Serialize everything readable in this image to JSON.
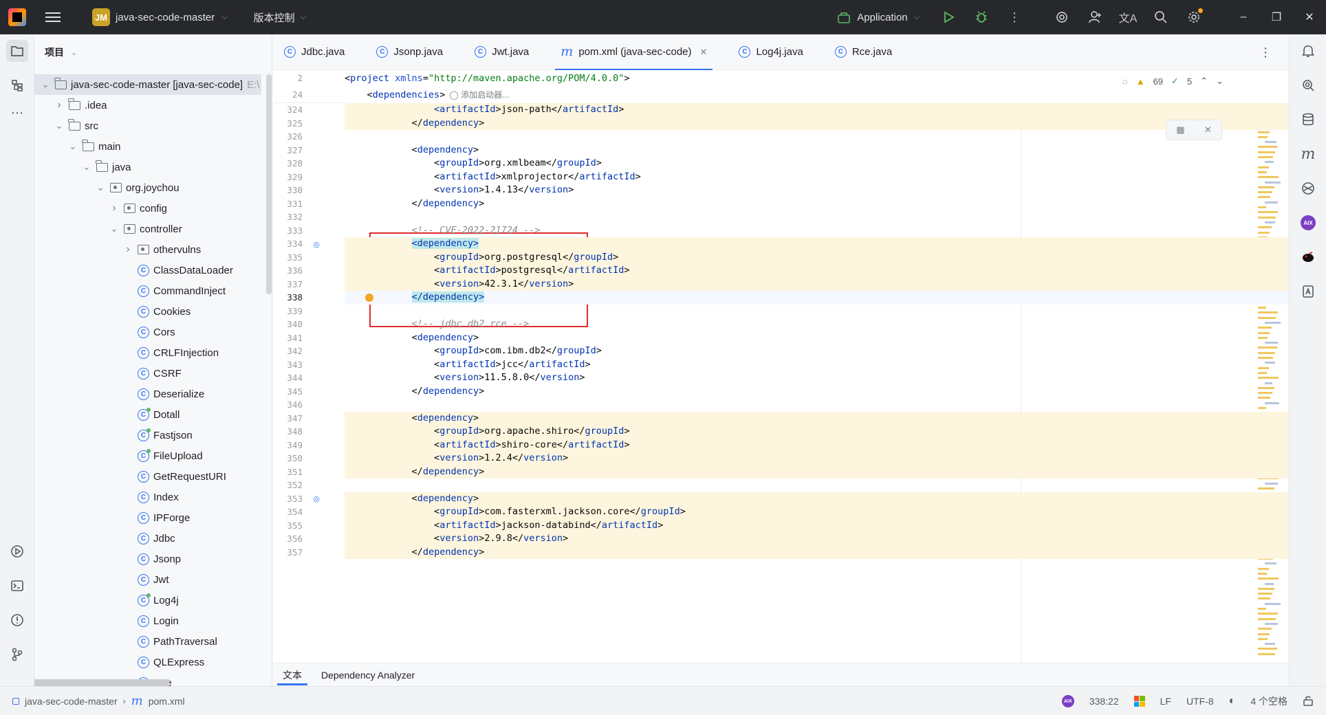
{
  "titlebar": {
    "project_avatar": "JM",
    "project_name": "java-sec-code-master",
    "vcs_label": "版本控制",
    "run_config": "Application"
  },
  "project_panel": {
    "title": "项目",
    "tree": [
      {
        "label": "java-sec-code-master [java-sec-code]",
        "suffix": "E:\\",
        "depth": 0,
        "kind": "module",
        "open": true
      },
      {
        "label": ".idea",
        "depth": 1,
        "kind": "folder",
        "open": false
      },
      {
        "label": "src",
        "depth": 1,
        "kind": "folder",
        "open": true
      },
      {
        "label": "main",
        "depth": 2,
        "kind": "folder",
        "open": true
      },
      {
        "label": "java",
        "depth": 3,
        "kind": "folder",
        "open": true
      },
      {
        "label": "org.joychou",
        "depth": 4,
        "kind": "package",
        "open": true
      },
      {
        "label": "config",
        "depth": 5,
        "kind": "package",
        "open": false
      },
      {
        "label": "controller",
        "depth": 5,
        "kind": "package",
        "open": true
      },
      {
        "label": "othervulns",
        "depth": 6,
        "kind": "package",
        "open": false
      },
      {
        "label": "ClassDataLoader",
        "depth": 6,
        "kind": "class"
      },
      {
        "label": "CommandInject",
        "depth": 6,
        "kind": "class"
      },
      {
        "label": "Cookies",
        "depth": 6,
        "kind": "class"
      },
      {
        "label": "Cors",
        "depth": 6,
        "kind": "class"
      },
      {
        "label": "CRLFInjection",
        "depth": 6,
        "kind": "class"
      },
      {
        "label": "CSRF",
        "depth": 6,
        "kind": "class"
      },
      {
        "label": "Deserialize",
        "depth": 6,
        "kind": "class"
      },
      {
        "label": "Dotall",
        "depth": 6,
        "kind": "class-g"
      },
      {
        "label": "Fastjson",
        "depth": 6,
        "kind": "class-g"
      },
      {
        "label": "FileUpload",
        "depth": 6,
        "kind": "class-g"
      },
      {
        "label": "GetRequestURI",
        "depth": 6,
        "kind": "class"
      },
      {
        "label": "Index",
        "depth": 6,
        "kind": "class"
      },
      {
        "label": "IPForge",
        "depth": 6,
        "kind": "class"
      },
      {
        "label": "Jdbc",
        "depth": 6,
        "kind": "class"
      },
      {
        "label": "Jsonp",
        "depth": 6,
        "kind": "class"
      },
      {
        "label": "Jwt",
        "depth": 6,
        "kind": "class"
      },
      {
        "label": "Log4j",
        "depth": 6,
        "kind": "class-g"
      },
      {
        "label": "Login",
        "depth": 6,
        "kind": "class"
      },
      {
        "label": "PathTraversal",
        "depth": 6,
        "kind": "class"
      },
      {
        "label": "QLExpress",
        "depth": 6,
        "kind": "class"
      },
      {
        "label": "Rce",
        "depth": 6,
        "kind": "class"
      }
    ]
  },
  "tabs": [
    {
      "label": "Jdbc.java",
      "icon": "class-icon",
      "active": false
    },
    {
      "label": "Jsonp.java",
      "icon": "class-icon",
      "active": false
    },
    {
      "label": "Jwt.java",
      "icon": "class-icon",
      "active": false
    },
    {
      "label": "pom.xml (java-sec-code)",
      "icon": "maven-icon",
      "active": true
    },
    {
      "label": "Log4j.java",
      "icon": "class-icon",
      "active": false
    },
    {
      "label": "Rce.java",
      "icon": "class-icon",
      "active": false
    }
  ],
  "inspections": {
    "warnings": "69",
    "ok": "5"
  },
  "sticky_lines": [
    {
      "num": "2",
      "html_kind": "project"
    },
    {
      "num": "24",
      "html_kind": "dependencies",
      "hint": "添加启动器..."
    }
  ],
  "code_lines": [
    {
      "num": "324",
      "indent": 2,
      "tokens": [
        [
          "t",
          "<artifactId"
        ],
        [
          "b",
          ">json-path</"
        ],
        [
          "t",
          "artifactId"
        ],
        [
          "b",
          ">"
        ]
      ],
      "hl": true
    },
    {
      "num": "325",
      "indent": 1,
      "tokens": [
        [
          "b",
          "</"
        ],
        [
          "t",
          "dependency"
        ],
        [
          "b",
          ">"
        ]
      ],
      "hl": true
    },
    {
      "num": "326",
      "indent": 0,
      "tokens": []
    },
    {
      "num": "327",
      "indent": 1,
      "tokens": [
        [
          "b",
          "<"
        ],
        [
          "t",
          "dependency"
        ],
        [
          "b",
          ">"
        ]
      ]
    },
    {
      "num": "328",
      "indent": 2,
      "tokens": [
        [
          "b",
          "<"
        ],
        [
          "t",
          "groupId"
        ],
        [
          "b",
          ">org.xmlbeam</"
        ],
        [
          "t",
          "groupId"
        ],
        [
          "b",
          ">"
        ]
      ]
    },
    {
      "num": "329",
      "indent": 2,
      "tokens": [
        [
          "b",
          "<"
        ],
        [
          "t",
          "artifactId"
        ],
        [
          "b",
          ">xmlprojector</"
        ],
        [
          "t",
          "artifactId"
        ],
        [
          "b",
          ">"
        ]
      ]
    },
    {
      "num": "330",
      "indent": 2,
      "tokens": [
        [
          "b",
          "<"
        ],
        [
          "t",
          "version"
        ],
        [
          "b",
          ">1.4.13</"
        ],
        [
          "t",
          "version"
        ],
        [
          "b",
          ">"
        ]
      ]
    },
    {
      "num": "331",
      "indent": 1,
      "tokens": [
        [
          "b",
          "</"
        ],
        [
          "t",
          "dependency"
        ],
        [
          "b",
          ">"
        ]
      ]
    },
    {
      "num": "332",
      "indent": 0,
      "tokens": []
    },
    {
      "num": "333",
      "indent": 1,
      "tokens": [
        [
          "c",
          "<!-- CVE-2022-21724 -->"
        ]
      ]
    },
    {
      "num": "334",
      "indent": 1,
      "tokens": [
        [
          "x",
          "<dependency>"
        ]
      ],
      "hl": true,
      "fold": true
    },
    {
      "num": "335",
      "indent": 2,
      "tokens": [
        [
          "b",
          "<"
        ],
        [
          "t",
          "groupId"
        ],
        [
          "b",
          ">org.postgresql</"
        ],
        [
          "t",
          "groupId"
        ],
        [
          "b",
          ">"
        ]
      ],
      "hl": true
    },
    {
      "num": "336",
      "indent": 2,
      "tokens": [
        [
          "b",
          "<"
        ],
        [
          "t",
          "artifactId"
        ],
        [
          "b",
          ">postgresql</"
        ],
        [
          "t",
          "artifactId"
        ],
        [
          "b",
          ">"
        ]
      ],
      "hl": true
    },
    {
      "num": "337",
      "indent": 2,
      "tokens": [
        [
          "b",
          "<"
        ],
        [
          "t",
          "version"
        ],
        [
          "b",
          ">42.3.1</"
        ],
        [
          "t",
          "version"
        ],
        [
          "b",
          ">"
        ]
      ],
      "hl": true
    },
    {
      "num": "338",
      "indent": 1,
      "tokens": [
        [
          "x",
          "</dependency>"
        ]
      ],
      "cur": true,
      "bulb": true
    },
    {
      "num": "339",
      "indent": 0,
      "tokens": []
    },
    {
      "num": "340",
      "indent": 1,
      "tokens": [
        [
          "c",
          "<!-- jdbc db2 rce -->"
        ]
      ]
    },
    {
      "num": "341",
      "indent": 1,
      "tokens": [
        [
          "b",
          "<"
        ],
        [
          "t",
          "dependency"
        ],
        [
          "b",
          ">"
        ]
      ]
    },
    {
      "num": "342",
      "indent": 2,
      "tokens": [
        [
          "b",
          "<"
        ],
        [
          "t",
          "groupId"
        ],
        [
          "b",
          ">com.ibm.db2</"
        ],
        [
          "t",
          "groupId"
        ],
        [
          "b",
          ">"
        ]
      ]
    },
    {
      "num": "343",
      "indent": 2,
      "tokens": [
        [
          "b",
          "<"
        ],
        [
          "t",
          "artifactId"
        ],
        [
          "b",
          ">jcc</"
        ],
        [
          "t",
          "artifactId"
        ],
        [
          "b",
          ">"
        ]
      ]
    },
    {
      "num": "344",
      "indent": 2,
      "tokens": [
        [
          "b",
          "<"
        ],
        [
          "t",
          "version"
        ],
        [
          "b",
          ">11.5.8.0</"
        ],
        [
          "t",
          "version"
        ],
        [
          "b",
          ">"
        ]
      ]
    },
    {
      "num": "345",
      "indent": 1,
      "tokens": [
        [
          "b",
          "</"
        ],
        [
          "t",
          "dependency"
        ],
        [
          "b",
          ">"
        ]
      ]
    },
    {
      "num": "346",
      "indent": 0,
      "tokens": []
    },
    {
      "num": "347",
      "indent": 1,
      "tokens": [
        [
          "b",
          "<"
        ],
        [
          "t",
          "dependency"
        ],
        [
          "b",
          ">"
        ]
      ],
      "hl": true
    },
    {
      "num": "348",
      "indent": 2,
      "tokens": [
        [
          "b",
          "<"
        ],
        [
          "t",
          "groupId"
        ],
        [
          "b",
          ">org.apache.shiro</"
        ],
        [
          "t",
          "groupId"
        ],
        [
          "b",
          ">"
        ]
      ],
      "hl": true
    },
    {
      "num": "349",
      "indent": 2,
      "tokens": [
        [
          "b",
          "<"
        ],
        [
          "t",
          "artifactId"
        ],
        [
          "b",
          ">shiro-core</"
        ],
        [
          "t",
          "artifactId"
        ],
        [
          "b",
          ">"
        ]
      ],
      "hl": true
    },
    {
      "num": "350",
      "indent": 2,
      "tokens": [
        [
          "b",
          "<"
        ],
        [
          "t",
          "version"
        ],
        [
          "b",
          ">1.2.4</"
        ],
        [
          "t",
          "version"
        ],
        [
          "b",
          ">"
        ]
      ],
      "hl": true
    },
    {
      "num": "351",
      "indent": 1,
      "tokens": [
        [
          "b",
          "</"
        ],
        [
          "t",
          "dependency"
        ],
        [
          "b",
          ">"
        ]
      ],
      "hl": true
    },
    {
      "num": "352",
      "indent": 0,
      "tokens": []
    },
    {
      "num": "353",
      "indent": 1,
      "tokens": [
        [
          "b",
          "<"
        ],
        [
          "t",
          "dependency"
        ],
        [
          "b",
          ">"
        ]
      ],
      "hl": true,
      "fold": true
    },
    {
      "num": "354",
      "indent": 2,
      "tokens": [
        [
          "b",
          "<"
        ],
        [
          "t",
          "groupId"
        ],
        [
          "b",
          ">com.fasterxml.jackson.core</"
        ],
        [
          "t",
          "groupId"
        ],
        [
          "b",
          ">"
        ]
      ],
      "hl": true
    },
    {
      "num": "355",
      "indent": 2,
      "tokens": [
        [
          "b",
          "<"
        ],
        [
          "t",
          "artifactId"
        ],
        [
          "b",
          ">jackson-databind</"
        ],
        [
          "t",
          "artifactId"
        ],
        [
          "b",
          ">"
        ]
      ],
      "hl": true
    },
    {
      "num": "356",
      "indent": 2,
      "tokens": [
        [
          "b",
          "<"
        ],
        [
          "t",
          "version"
        ],
        [
          "b",
          ">2.9.8</"
        ],
        [
          "t",
          "version"
        ],
        [
          "b",
          ">"
        ]
      ],
      "hl": true
    },
    {
      "num": "357",
      "indent": 1,
      "tokens": [
        [
          "b",
          "</"
        ],
        [
          "t",
          "dependency"
        ],
        [
          "b",
          ">"
        ]
      ],
      "hl": true
    }
  ],
  "sticky_text": {
    "project_open": "<",
    "project_tag": "project",
    "project_attr": " xmlns",
    "project_eq": "=",
    "project_val": "\"http://maven.apache.org/POM/4.0.0\"",
    "project_close": ">",
    "deps_open": "<",
    "deps_tag": "dependencies",
    "deps_close": ">",
    "deps_hint": "添加启动器..."
  },
  "bottom_tabs": [
    {
      "label": "文本",
      "active": true
    },
    {
      "label": "Dependency Analyzer",
      "active": false
    }
  ],
  "statusbar": {
    "crumb_project": "java-sec-code-master",
    "crumb_file": "pom.xml",
    "position": "338:22",
    "line_sep": "LF",
    "encoding": "UTF-8",
    "indent": "4 个空格"
  },
  "colors": {
    "accent": "#3574f0",
    "highlight": "#fdf5dd",
    "red_box": "#e02a2a",
    "tag": "#0033b3"
  }
}
